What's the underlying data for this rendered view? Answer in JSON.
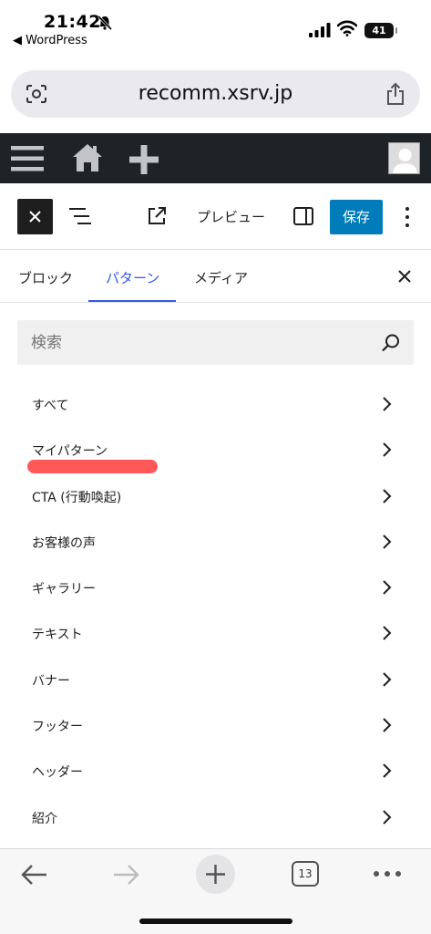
{
  "status_bar": {
    "time": "21:42",
    "back_label": "◀ WordPress",
    "battery": "41"
  },
  "url_bar": {
    "url": "recomm.xsrv.jp"
  },
  "editor_toolbar": {
    "preview_label": "プレビュー",
    "save_label": "保存"
  },
  "tabs": {
    "block": "ブロック",
    "pattern": "パターン",
    "media": "メディア"
  },
  "search": {
    "placeholder": "検索"
  },
  "categories": [
    "すべて",
    "マイパターン",
    "CTA (行動喚起)",
    "お客様の声",
    "ギャラリー",
    "テキスト",
    "バナー",
    "フッター",
    "ヘッダー",
    "紹介"
  ],
  "bottom_bar": {
    "tab_count": "13"
  },
  "colors": {
    "admin_bar": "#1d2327",
    "accent": "#3858e9",
    "save_button": "#007cba"
  }
}
